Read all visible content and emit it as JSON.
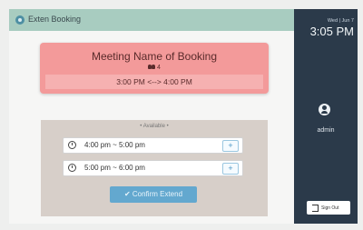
{
  "header": {
    "title": "Exten Booking"
  },
  "booking": {
    "name": "Meeting Name of Booking",
    "attendees": "4",
    "time_range": "3:00 PM <--> 4:00 PM"
  },
  "availability": {
    "label": "• Available •",
    "slots": [
      {
        "time": "4:00 pm ~ 5:00 pm",
        "action": "+"
      },
      {
        "time": "5:00 pm ~ 6:00 pm",
        "action": "+"
      }
    ],
    "confirm_label": "✔ Confirm Extend"
  },
  "sidebar": {
    "date": "Wed | Jun 7",
    "time": "3:05 PM",
    "username": "admin",
    "signout_label": "Sign Out"
  }
}
